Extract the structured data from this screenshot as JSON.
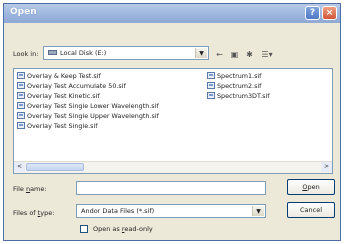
{
  "window": {
    "title": "Open"
  },
  "titlebar": {
    "help_glyph": "?",
    "close_glyph": "×"
  },
  "lookin": {
    "label": "Look in:",
    "value": "Local Disk (E:)"
  },
  "toolbar": {
    "back_glyph": "←",
    "up_glyph": "▣",
    "newfolder_glyph": "✱",
    "views_glyph": "☰▾"
  },
  "files": {
    "column1": [
      "Overlay & Keep Test.sif",
      "Overlay Test Accumulate 50.sif",
      "Overlay Test Kinetic.sif",
      "Overlay Test Single Lower Wavelength.sif",
      "Overlay Test Single Upper Wavelength.sif",
      "Overlay Test Single.sif"
    ],
    "column2": [
      "Spectrum1.sif",
      "Spectrum2.sif",
      "Spectrum3DT.sif"
    ]
  },
  "scrollbar": {
    "left_glyph": "<",
    "right_glyph": ">"
  },
  "filename": {
    "label": "File name:",
    "value": ""
  },
  "filetype": {
    "label": "Files of type:",
    "value": "Andor Data Files (*.sif)"
  },
  "buttons": {
    "open": "Open",
    "cancel": "Cancel"
  },
  "readonly": {
    "label": "Open as read-only",
    "checked": false
  },
  "icons": [
    "help-icon",
    "close-icon",
    "drive-icon",
    "back-icon",
    "up-folder-icon",
    "new-folder-icon",
    "views-icon",
    "file-icon"
  ]
}
